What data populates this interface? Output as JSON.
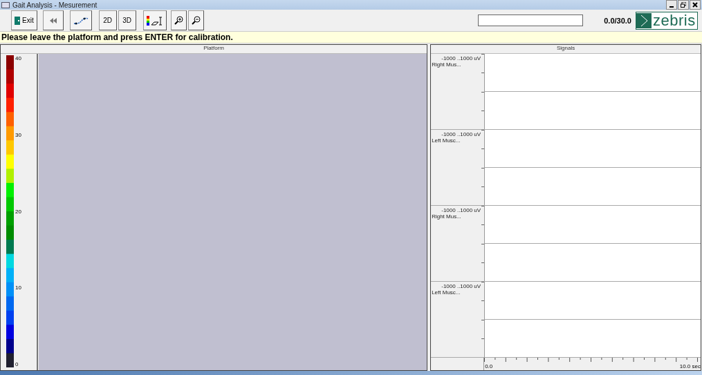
{
  "window": {
    "title": "Gait Analysis - Mesurement"
  },
  "toolbar": {
    "buttons": [
      {
        "kind": "exit",
        "label": "Exit"
      },
      {
        "kind": "rewind"
      },
      {
        "kind": "walk"
      },
      {
        "kind": "text",
        "label": "2D"
      },
      {
        "kind": "text",
        "label": "3D"
      },
      {
        "kind": "scale"
      },
      {
        "kind": "zoom-in"
      },
      {
        "kind": "zoom-out"
      }
    ],
    "time": "0.0/30.0",
    "logo": "zebris"
  },
  "message": "Please leave the platform and press ENTER for calibration.",
  "platform": {
    "title": "Platform",
    "scale_labels": [
      "40",
      "30",
      "20",
      "10",
      "0"
    ]
  },
  "signals": {
    "title": "Signals",
    "channels": [
      {
        "range": "-1000 ..1000 uV",
        "name": "Right Mus..."
      },
      {
        "range": "-1000 ..1000 uV",
        "name": "Left Musc..."
      },
      {
        "range": "-1000 ..1000 uV",
        "name": "Right Mus..."
      },
      {
        "range": "-1000 ..1000 uV",
        "name": "Left Musc..."
      }
    ],
    "time_start": "0.0",
    "time_end": "10.0 sec"
  }
}
